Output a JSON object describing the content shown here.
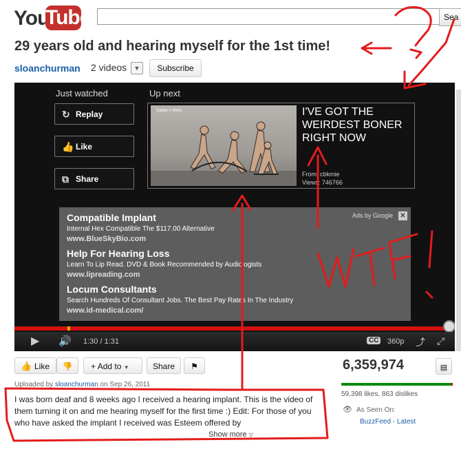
{
  "header": {
    "logo_you": "You",
    "logo_tube": "Tube",
    "search_value": "",
    "search_button": "Sea"
  },
  "video": {
    "title": "29 years old and hearing myself for the 1st time!",
    "channel": "sloanchurman",
    "video_count": "2 videos",
    "subscribe": "Subscribe"
  },
  "player": {
    "just_watched": "Just watched",
    "up_next": "Up next",
    "replay": "Replay",
    "like": "Like",
    "share": "Share",
    "next_thumb_caption": "Sadler's Wells",
    "next_title": "I'VE GOT THE WEIRDEST BONER RIGHT NOW",
    "next_from": "From:   cbkmie",
    "next_views": "Views:   746766",
    "ads_by": "Ads by Google",
    "ads": [
      {
        "title": "Compatible Implant",
        "text": "Internal Hex Compatible The $117.00 Alternative",
        "url": "www.BlueSkyBio.com"
      },
      {
        "title": "Help For Hearing Loss",
        "text": "Learn To Lip Read. DVD & Book Recommended by Audiologists",
        "url": "www.lipreading.com"
      },
      {
        "title": "Locum Consultants",
        "text": "Search Hundreds Of Consultant Jobs. The Best Pay Rates In The Industry",
        "url": "www.id-medical.com/"
      }
    ],
    "time": "1:30 / 1:31",
    "quality": "360p",
    "cc": "CC",
    "progress": 0.99,
    "loaded_marker": 0.12
  },
  "actions": {
    "like": "Like",
    "add_to": "Add to",
    "share": "Share",
    "views": "6,359,974",
    "likes_text": "59,398 likes, 863 dislikes",
    "like_ratio": 0.986,
    "as_seen_on": "As Seen On:",
    "seen_on_link": "BuzzFeed - Latest"
  },
  "description": {
    "uploaded_prefix": "Uploaded by",
    "uploader": "sloanchurman",
    "uploaded_date": "on Sep 26, 2011",
    "text": "I was born deaf and 8 weeks ago I received a hearing implant. This is the video of them turning it on and me hearing myself for the first time :) Edit: For those of you who have asked the implant I received was Esteem offered by",
    "show_more": "Show more"
  },
  "annotations": {
    "question_mark": "?",
    "wtf": "WTF!"
  },
  "colors": {
    "brand_red": "#c4302b",
    "annotation_red": "#e41b1b",
    "link_blue": "#1a5ea6"
  }
}
